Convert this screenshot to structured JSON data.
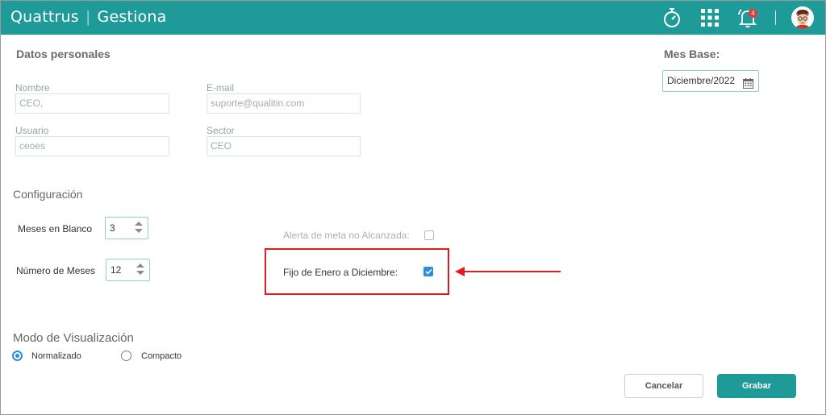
{
  "header": {
    "brand_left": "Quattrus",
    "brand_sep": "|",
    "brand_right": "Gestiona",
    "notification_count": "4",
    "accent_color": "#1e9a98",
    "icons": [
      "stopwatch-icon",
      "apps-grid-icon",
      "bell-icon",
      "avatar"
    ]
  },
  "personal": {
    "title": "Datos personales",
    "fields": {
      "nombre": {
        "label": "Nombre",
        "value": "CEO,"
      },
      "email": {
        "label": "E-mail",
        "value": "suporte@qualitin.com"
      },
      "usuario": {
        "label": "Usuario",
        "value": "ceoes"
      },
      "sector": {
        "label": "Sector",
        "value": "CEO"
      }
    }
  },
  "mes_base": {
    "title": "Mes Base:",
    "value": "Diciembre/2022"
  },
  "config": {
    "title": "Configuración",
    "meses_blanco": {
      "label": "Meses en Blanco",
      "value": "3"
    },
    "numero_meses": {
      "label": "Número de Meses",
      "value": "12"
    },
    "alerta_meta": {
      "label": "Alerta de meta no Alcanzada:",
      "checked": false
    },
    "fijo_enero": {
      "label": "Fijo de Enero a Diciembre:",
      "checked": true
    }
  },
  "modo": {
    "title": "Modo de Visualización",
    "options": [
      {
        "label": "Normalizado",
        "selected": true
      },
      {
        "label": "Compacto",
        "selected": false
      }
    ]
  },
  "actions": {
    "cancel_label": "Cancelar",
    "save_label": "Grabar"
  },
  "annotation_color": "#e31b1b"
}
